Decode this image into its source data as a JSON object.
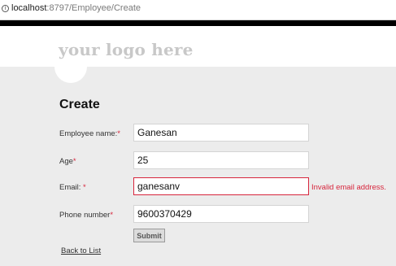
{
  "browser": {
    "url_host": "localhost",
    "url_path": ":8797/Employee/Create",
    "info_icon": "info-icon"
  },
  "site": {
    "logo_text": "your logo here"
  },
  "form": {
    "heading": "Create",
    "fields": [
      {
        "label": "Employee name:",
        "required_mark": "*",
        "value": "Ganesan"
      },
      {
        "label": "Age",
        "required_mark": "*",
        "value": "25"
      },
      {
        "label": "Email: ",
        "required_mark": "*",
        "value": "ganesanv",
        "error": "Invalid email address."
      },
      {
        "label": "Phone number",
        "required_mark": "*",
        "value": "9600370429"
      }
    ],
    "submit_label": "Submit",
    "back_link": "Back to List"
  },
  "colors": {
    "background": "#ececec",
    "error": "#d7263d",
    "logo": "#c8c8c8"
  }
}
